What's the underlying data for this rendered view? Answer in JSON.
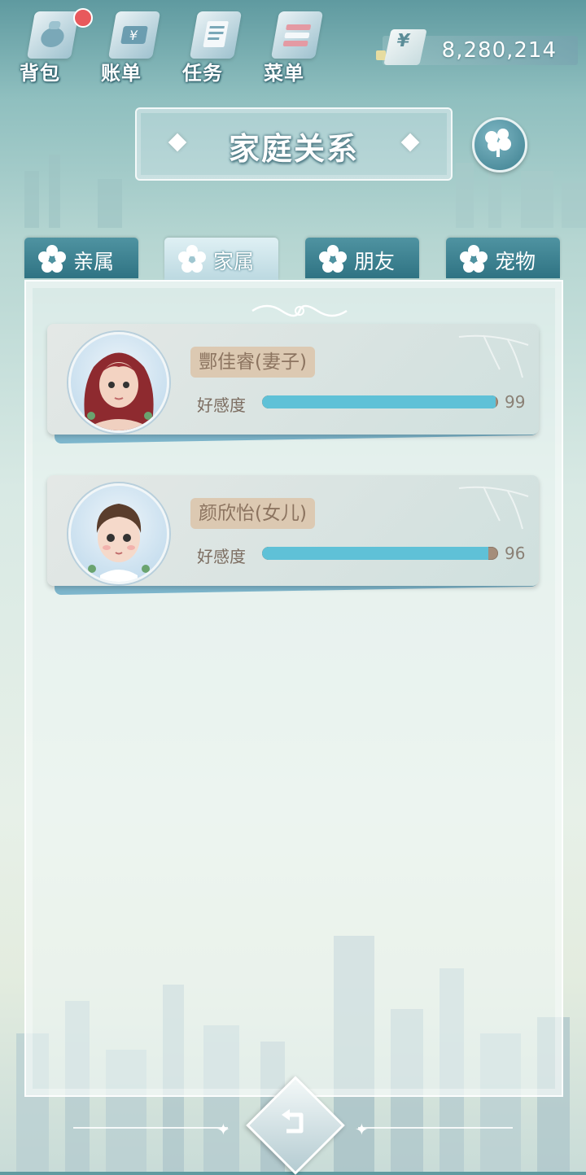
{
  "topnav": {
    "items": [
      {
        "label": "背包",
        "icon": "backpack-icon",
        "badge": true
      },
      {
        "label": "账单",
        "icon": "bill-icon",
        "badge": false
      },
      {
        "label": "任务",
        "icon": "task-icon",
        "badge": false
      },
      {
        "label": "菜单",
        "icon": "menu-icon",
        "badge": false
      }
    ]
  },
  "currency": {
    "symbol": "¥",
    "amount": "8,280,214"
  },
  "header": {
    "title": "家庭关系"
  },
  "tabs": [
    {
      "label": "亲属",
      "active": false
    },
    {
      "label": "家属",
      "active": true
    },
    {
      "label": "朋友",
      "active": false
    },
    {
      "label": "宠物",
      "active": false
    }
  ],
  "members": [
    {
      "name": "酆佳睿(妻子)",
      "affinity_label": "好感度",
      "affinity": 99,
      "affinity_fraction": 0.99
    },
    {
      "name": "颜欣怡(女儿)",
      "affinity_label": "好感度",
      "affinity": 96,
      "affinity_fraction": 0.96
    }
  ],
  "colors": {
    "tab_inactive": "#2f7383",
    "tab_active": "#dff0f4",
    "affinity_fill": "#5fc1d7",
    "badge": "#e8595c"
  }
}
